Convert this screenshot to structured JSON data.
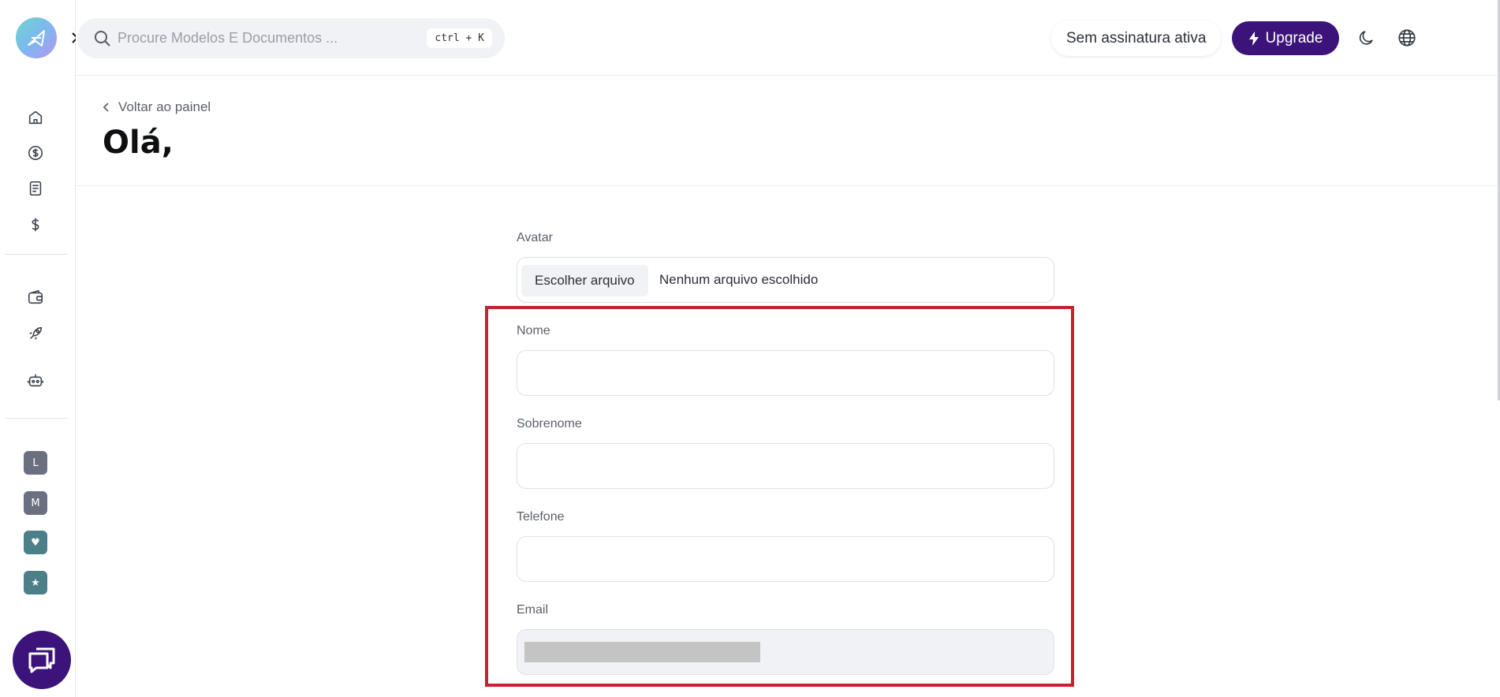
{
  "search": {
    "placeholder": "Procure Modelos E Documentos ...",
    "shortcut": "ctrl + K",
    "icon": "search-icon"
  },
  "topbar": {
    "subscription_status": "Sem assinatura ativa",
    "upgrade_label": "Upgrade",
    "colors": {
      "upgrade_bg": "#3b137a"
    }
  },
  "sidebar": {
    "nav_icons": [
      "home-icon",
      "dollar-circle-icon",
      "document-icon",
      "dollar-icon",
      "wallet-icon",
      "rocket-icon",
      "robot-icon"
    ],
    "workspaces": [
      {
        "label": "L",
        "color": "#6b7080"
      },
      {
        "label": "M",
        "color": "#6b7080"
      },
      {
        "label": "♥",
        "color": "#4c7f87"
      },
      {
        "label": "★",
        "color": "#4c7f87"
      }
    ]
  },
  "header": {
    "back_label": "Voltar ao painel",
    "title": "Olá,"
  },
  "form": {
    "avatar_label": "Avatar",
    "file_button": "Escolher arquivo",
    "file_status": "Nenhum arquivo escolhido",
    "first_name_label": "Nome",
    "first_name_value": "",
    "last_name_label": "Sobrenome",
    "last_name_value": "",
    "phone_label": "Telefone",
    "phone_value": "",
    "email_label": "Email"
  },
  "colors": {
    "accent": "#3b137a",
    "highlight": "#cc1f2f"
  }
}
